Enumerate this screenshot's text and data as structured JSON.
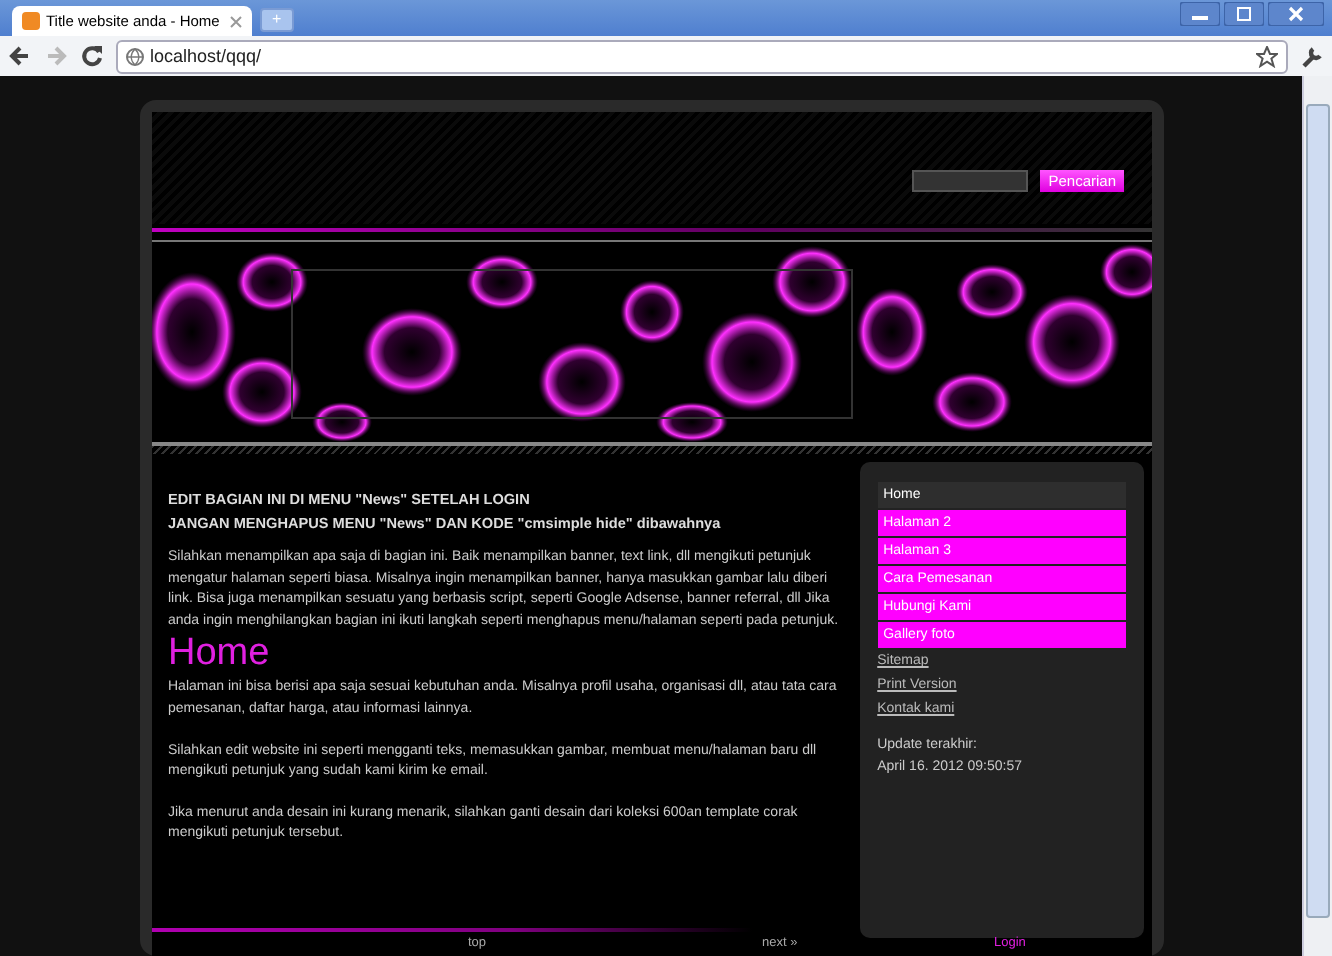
{
  "browser": {
    "tab_title": "Title website anda - Home",
    "new_tab": "+",
    "url": "localhost/qqq/"
  },
  "header": {
    "search_button": "Pencarian"
  },
  "notice": {
    "headings": [
      "EDIT BAGIAN INI DI MENU \"News\" SETELAH LOGIN",
      "JANGAN MENGHAPUS MENU \"News\" DAN KODE \"cmsimple hide\" dibawahnya"
    ],
    "text": "Silahkan menampilkan apa saja di bagian ini. Baik menampilkan banner, text link, dll mengikuti petunjuk mengatur halaman seperti biasa. Misalnya ingin menampilkan banner, hanya masukkan gambar lalu diberi link. Bisa juga menampilkan sesuatu yang berbasis script, seperti Google Adsense, banner referral, dll Jika anda ingin menghilangkan bagian ini ikuti langkah seperti menghapus menu/halaman seperti pada petunjuk."
  },
  "page_title": "Home",
  "paragraphs": [
    "Halaman ini bisa berisi apa saja sesuai kebutuhan anda. Misalnya profil usaha, organisasi dll, atau tata cara pemesanan, daftar harga, atau informasi lainnya.",
    "Silahkan edit website ini seperti mengganti teks, memasukkan gambar, membuat menu/halaman baru dll mengikuti petunjuk yang sudah kami kirim ke email.",
    "Jika menurut anda desain ini kurang menarik, silahkan ganti desain dari koleksi 600an template corak mengikuti petunjuk tersebut."
  ],
  "sidebar": {
    "menu": [
      {
        "label": "Home",
        "selected": true
      },
      {
        "label": "Halaman 2",
        "selected": false
      },
      {
        "label": "Halaman 3",
        "selected": false
      },
      {
        "label": "Cara Pemesanan",
        "selected": false
      },
      {
        "label": "Hubungi Kami",
        "selected": false
      },
      {
        "label": "Gallery foto",
        "selected": false
      }
    ],
    "links": [
      "Sitemap",
      "Print Version",
      "Kontak kami"
    ],
    "update_label": "Update terakhir:",
    "update_date": "April 16. 2012 09:50:57"
  },
  "footer": {
    "top": "top",
    "next": "next »",
    "login": "Login"
  }
}
